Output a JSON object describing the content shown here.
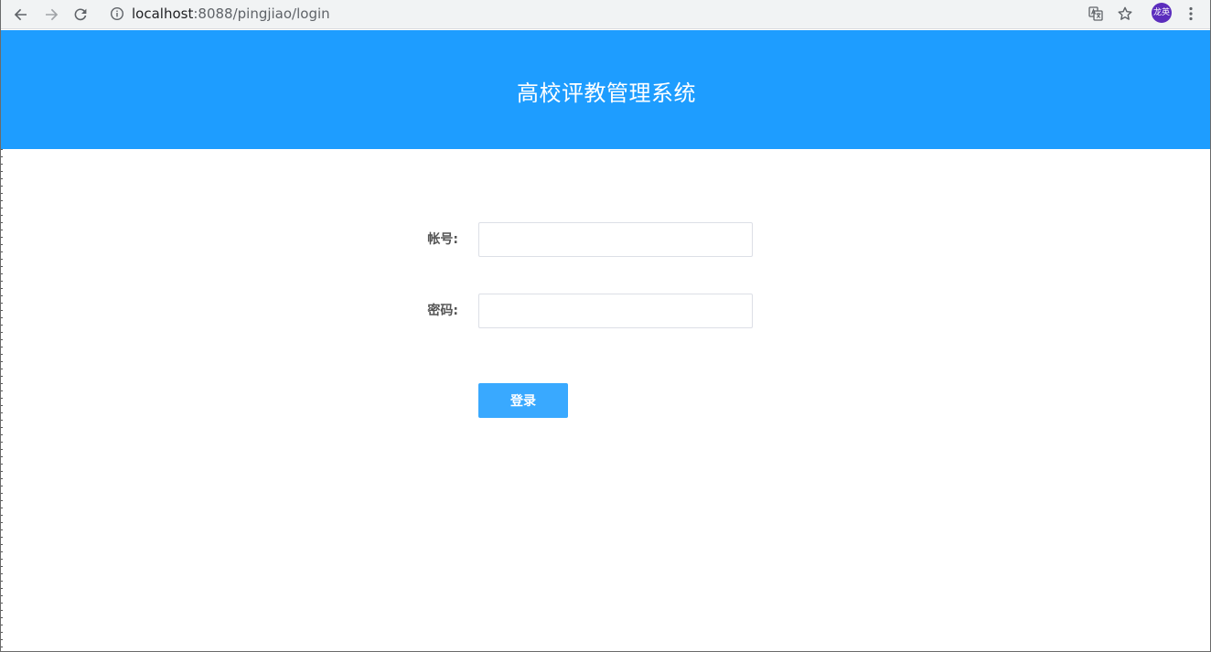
{
  "browser": {
    "url_host": "localhost",
    "url_rest": ":8088/pingjiao/login",
    "profile_initials": "龙英",
    "icons": {
      "back": "back-arrow-icon",
      "forward": "forward-arrow-icon",
      "reload": "reload-icon",
      "info": "info-icon",
      "translate": "translate-icon",
      "bookmark": "star-icon",
      "menu": "kebab-menu-icon"
    }
  },
  "header": {
    "title": "高校评教管理系统"
  },
  "login_form": {
    "account_label": "帐号:",
    "account_value": "",
    "account_placeholder": "",
    "password_label": "密码:",
    "password_value": "",
    "password_placeholder": "",
    "submit_label": "登录"
  },
  "colors": {
    "header_bg": "#1e9dff",
    "button_bg": "#39a9ff",
    "avatar_bg": "#5b2dbd"
  }
}
